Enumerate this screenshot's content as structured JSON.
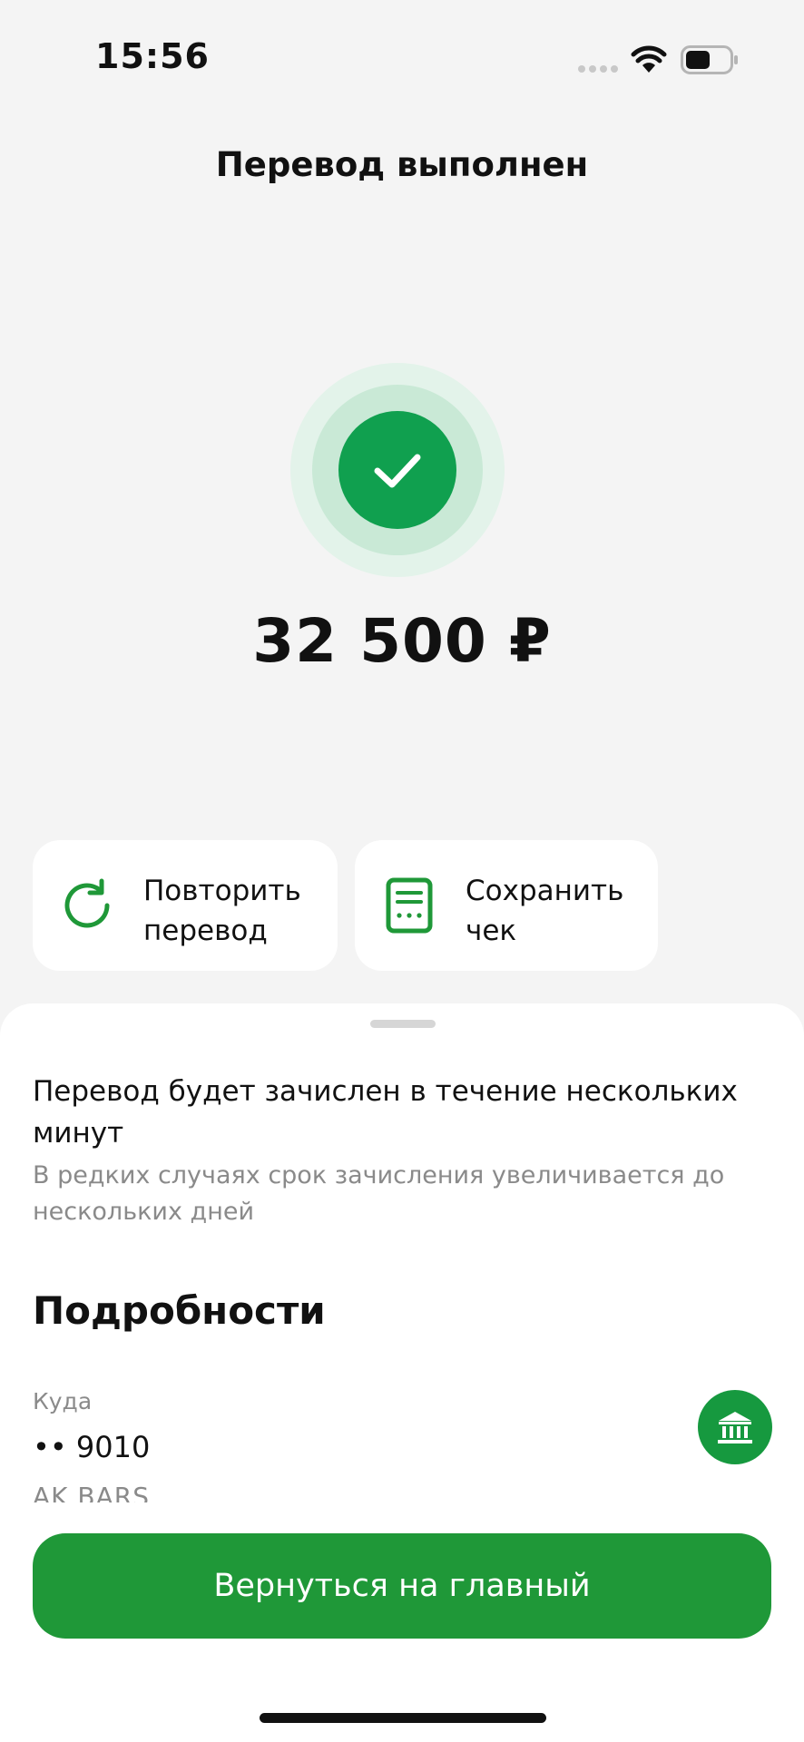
{
  "status_bar": {
    "time": "15:56"
  },
  "header": {
    "title": "Перевод выполнен"
  },
  "transfer": {
    "amount": "32 500 ₽",
    "status_icon": "check-icon"
  },
  "actions": [
    {
      "line1": "Повторить",
      "line2": "перевод",
      "icon": "repeat-icon"
    },
    {
      "line1": "Сохранить",
      "line2": "чек",
      "icon": "receipt-icon"
    }
  ],
  "sheet": {
    "info_title": "Перевод будет зачислен в течение нескольких минут",
    "info_subtitle": "В редких случаях срок зачисления увеличивается до нескольких дней",
    "details_heading": "Подробности",
    "destination": {
      "label": "Куда",
      "value": "•• 9010",
      "bank": "AK BARS",
      "icon": "bank-icon"
    }
  },
  "footer": {
    "home_button": "Вернуться на главный"
  },
  "colors": {
    "accent": "#1f9838",
    "success": "#10a04f",
    "background": "#f4f4f4",
    "muted_text": "#8a8a8a"
  }
}
